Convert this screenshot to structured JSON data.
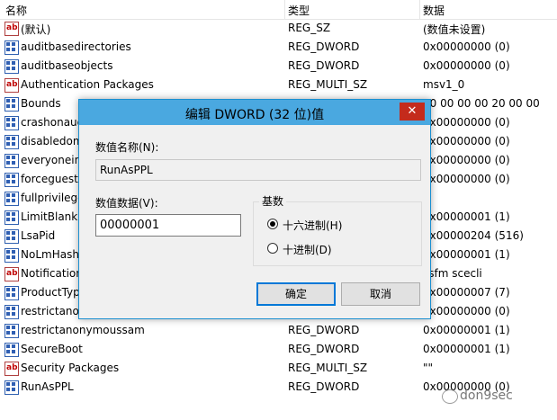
{
  "columns": {
    "name": "名称",
    "type": "类型",
    "data": "数据"
  },
  "rows": [
    {
      "icon": "ab",
      "name": "(默认)",
      "type": "REG_SZ",
      "data": "(数值未设置)"
    },
    {
      "icon": "bin",
      "name": "auditbasedirectories",
      "type": "REG_DWORD",
      "data": "0x00000000 (0)"
    },
    {
      "icon": "bin",
      "name": "auditbaseobjects",
      "type": "REG_DWORD",
      "data": "0x00000000 (0)"
    },
    {
      "icon": "ab",
      "name": "Authentication Packages",
      "type": "REG_MULTI_SZ",
      "data": "msv1_0"
    },
    {
      "icon": "bin",
      "name": "Bounds",
      "type": "",
      "data": "30 00 00 00 20 00 00"
    },
    {
      "icon": "bin",
      "name": "crashonaud",
      "type": "",
      "data": "0x00000000 (0)"
    },
    {
      "icon": "bin",
      "name": "disabledom",
      "type": "",
      "data": "0x00000000 (0)"
    },
    {
      "icon": "bin",
      "name": "everyoneinc",
      "type": "",
      "data": "0x00000000 (0)"
    },
    {
      "icon": "bin",
      "name": "forceguest",
      "type": "",
      "data": "0x00000000 (0)"
    },
    {
      "icon": "bin",
      "name": "fullprivilege",
      "type": "",
      "data": ""
    },
    {
      "icon": "bin",
      "name": "LimitBlankP",
      "type": "",
      "data": "0x00000001 (1)"
    },
    {
      "icon": "bin",
      "name": "LsaPid",
      "type": "",
      "data": "0x00000204 (516)"
    },
    {
      "icon": "bin",
      "name": "NoLmHash",
      "type": "",
      "data": "0x00000001 (1)"
    },
    {
      "icon": "ab",
      "name": "Notification",
      "type": "",
      "data": "ssfm scecli"
    },
    {
      "icon": "bin",
      "name": "ProductTyp",
      "type": "",
      "data": "0x00000007 (7)"
    },
    {
      "icon": "bin",
      "name": "restrictanon",
      "type": "",
      "data": "0x00000000 (0)"
    },
    {
      "icon": "bin",
      "name": "restrictanonymoussam",
      "type": "REG_DWORD",
      "data": "0x00000001 (1)"
    },
    {
      "icon": "bin",
      "name": "SecureBoot",
      "type": "REG_DWORD",
      "data": "0x00000001 (1)"
    },
    {
      "icon": "ab",
      "name": "Security Packages",
      "type": "REG_MULTI_SZ",
      "data": "\"\""
    },
    {
      "icon": "bin",
      "name": "RunAsPPL",
      "type": "REG_DWORD",
      "data": "0x00000000 (0)"
    }
  ],
  "dialog": {
    "title": "编辑 DWORD (32 位)值",
    "close": "✕",
    "value_name_label": "数值名称(N):",
    "value_name": "RunAsPPL",
    "value_data_label": "数值数据(V):",
    "value_data": "00000001",
    "base_label": "基数",
    "hex_label": "十六进制(H)",
    "dec_label": "十进制(D)",
    "base_selected": "hex",
    "ok": "确定",
    "cancel": "取消"
  },
  "watermark": "don9sec"
}
